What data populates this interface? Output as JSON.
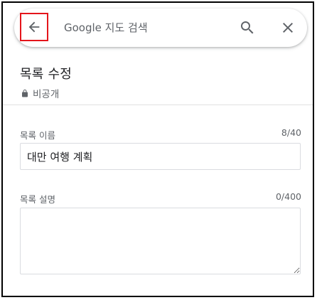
{
  "search": {
    "placeholder": "Google 지도 검색",
    "value": ""
  },
  "icons": {
    "back": "arrow-back-icon",
    "search": "search-icon",
    "close": "close-icon",
    "lock": "lock-icon"
  },
  "colors": {
    "highlight_border": "#e4151b",
    "text_primary": "#202124",
    "text_secondary": "#5f6368"
  },
  "header": {
    "title": "목록 수정",
    "privacy_label": "비공개"
  },
  "form": {
    "name": {
      "label": "목록 이름",
      "value": "대만 여행 계획",
      "count": "8/40"
    },
    "description": {
      "label": "목록 설명",
      "value": "",
      "count": "0/400"
    }
  }
}
